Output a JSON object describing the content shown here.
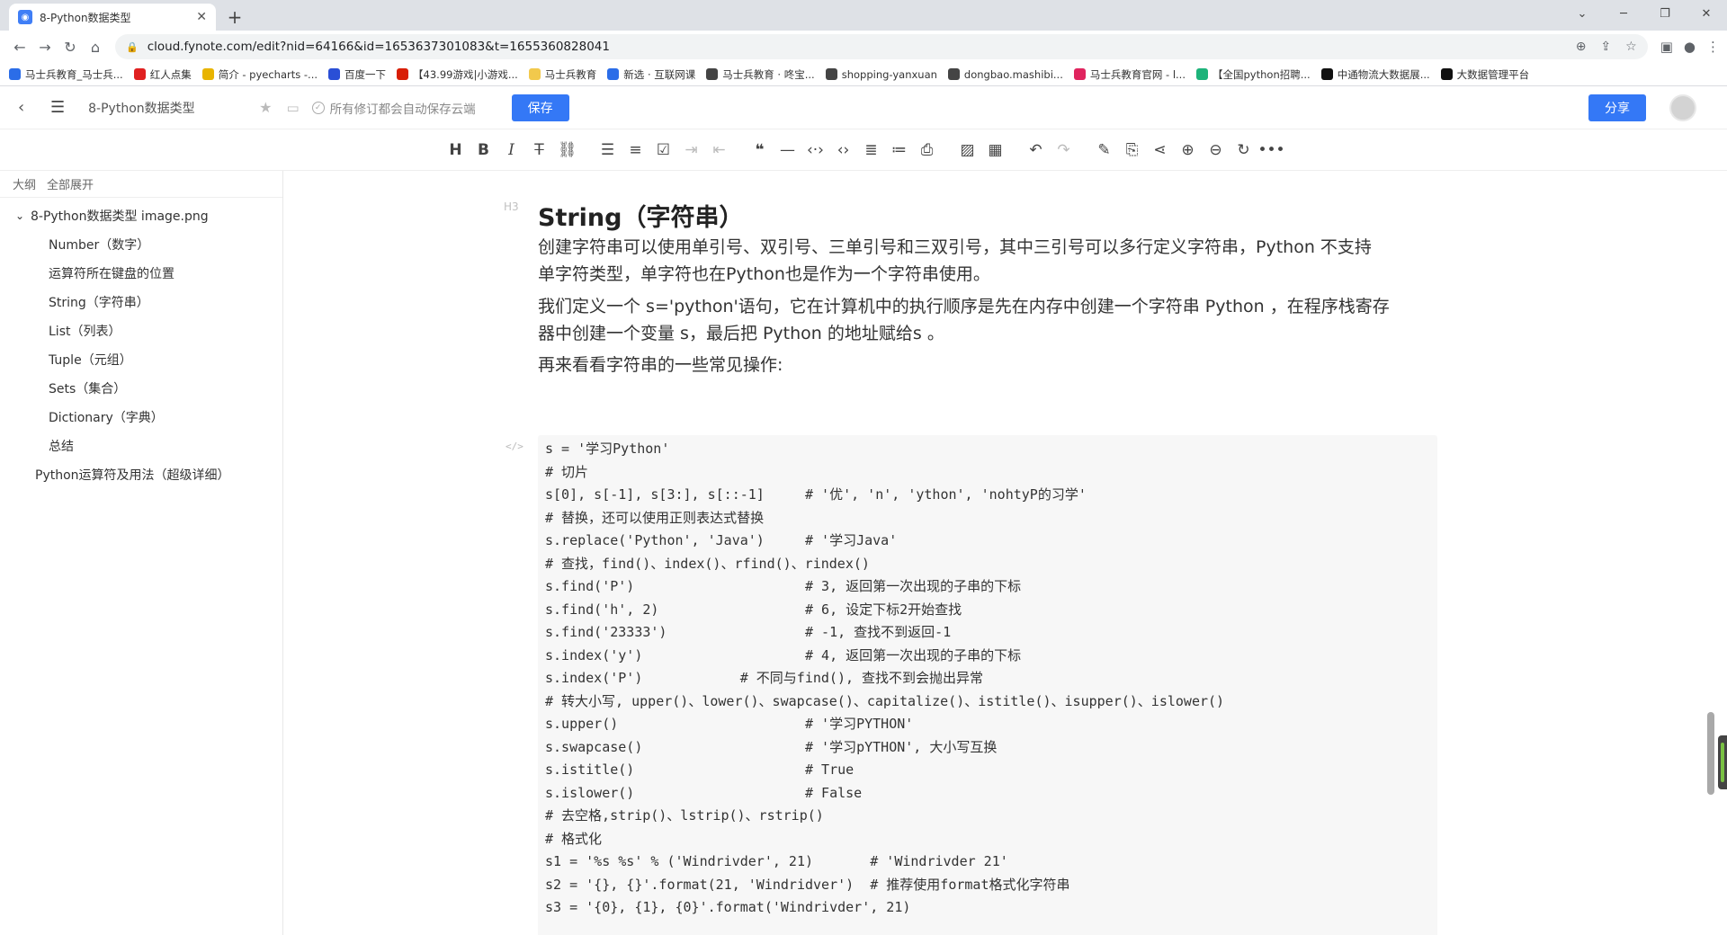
{
  "browser": {
    "tab_title": "8-Python数据类型",
    "url": "cloud.fynote.com/edit?nid=64166&id=1653637301083&t=1655360828041",
    "bookmarks": [
      {
        "label": "马士兵教育_马士兵...",
        "color": "#2b6de8"
      },
      {
        "label": "红人点集",
        "color": "#e02020"
      },
      {
        "label": "简介 - pyecharts -...",
        "color": "#e8b400"
      },
      {
        "label": "百度一下",
        "color": "#2a4fd6"
      },
      {
        "label": "【43.99游戏|小游戏...",
        "color": "#d81e06"
      },
      {
        "label": "马士兵教育",
        "color": "#f2c94c"
      },
      {
        "label": "新选 · 互联网课",
        "color": "#2b6de8"
      },
      {
        "label": "马士兵教育 · 咚宝...",
        "color": "#444444"
      },
      {
        "label": "shopping-yanxuan",
        "color": "#444444"
      },
      {
        "label": "dongbao.mashibi...",
        "color": "#444444"
      },
      {
        "label": "马士兵教育官网 - l...",
        "color": "#e0245e"
      },
      {
        "label": "【全国python招聘...",
        "color": "#1db37a"
      },
      {
        "label": "中通物流大数据展...",
        "color": "#111111"
      },
      {
        "label": "大数据管理平台",
        "color": "#111111"
      }
    ]
  },
  "app": {
    "doc_title": "8-Python数据类型",
    "saved_status": "所有修订都会自动保存云端",
    "save_label": "保存",
    "share_label": "分享"
  },
  "sidebar": {
    "outline_label": "大纲",
    "expand_all_label": "全部展开",
    "root_item": "8-Python数据类型 image.png",
    "children": [
      "Number（数字）",
      "运算符所在键盘的位置",
      "String（字符串）",
      "List（列表）",
      "Tuple（元组）",
      "Sets（集合）",
      "Dictionary（字典）",
      "总结"
    ],
    "sibling_item": "Python运算符及用法（超级详细）"
  },
  "article": {
    "heading_marker": "H3",
    "heading": "String（字符串）",
    "para1_line1": "创建字符串可以使用单引号、双引号、三单引号和三双引号，其中三引号可以多行定义字符串，Python 不支持",
    "para1_line2": "单字符类型，单字符也在Python也是作为一个字符串使用。",
    "para2_line1": "我们定义一个 s='python'语句，它在计算机中的执行顺序是先在内存中创建一个字符串 Python ，在程序栈寄存",
    "para2_line2": "器中创建一个变量 s，最后把 Python  的地址赋给s 。",
    "para3": "再来看看字符串的一些常见操作:",
    "code_marker": "</>",
    "code_lines": [
      "s = '学习Python'",
      "# 切片",
      "s[0], s[-1], s[3:], s[::-1]     # '优', 'n', 'ython', 'nohtyP的习学'",
      "# 替换，还可以使用正则表达式替换",
      "s.replace('Python', 'Java')     # '学习Java'",
      "# 查找，find()、index()、rfind()、rindex()",
      "s.find('P')                     # 3, 返回第一次出现的子串的下标",
      "s.find('h', 2)                  # 6, 设定下标2开始查找",
      "s.find('23333')                 # -1, 查找不到返回-1",
      "s.index('y')                    # 4, 返回第一次出现的子串的下标",
      "s.index('P')            # 不同与find(), 查找不到会抛出异常",
      "# 转大小写, upper()、lower()、swapcase()、capitalize()、istitle()、isupper()、islower()",
      "s.upper()                       # '学习PYTHON'",
      "s.swapcase()                    # '学习pYTHON', 大小写互换",
      "s.istitle()                     # True",
      "s.islower()                     # False",
      "# 去空格,strip()、lstrip()、rstrip()",
      "# 格式化",
      "s1 = '%s %s' % ('Windrivder', 21)       # 'Windrivder 21'",
      "s2 = '{}, {}'.format(21, 'Windridver')  # 推荐使用format格式化字符串",
      "s3 = '{0}, {1}, {0}'.format('Windrivder', 21)"
    ]
  }
}
